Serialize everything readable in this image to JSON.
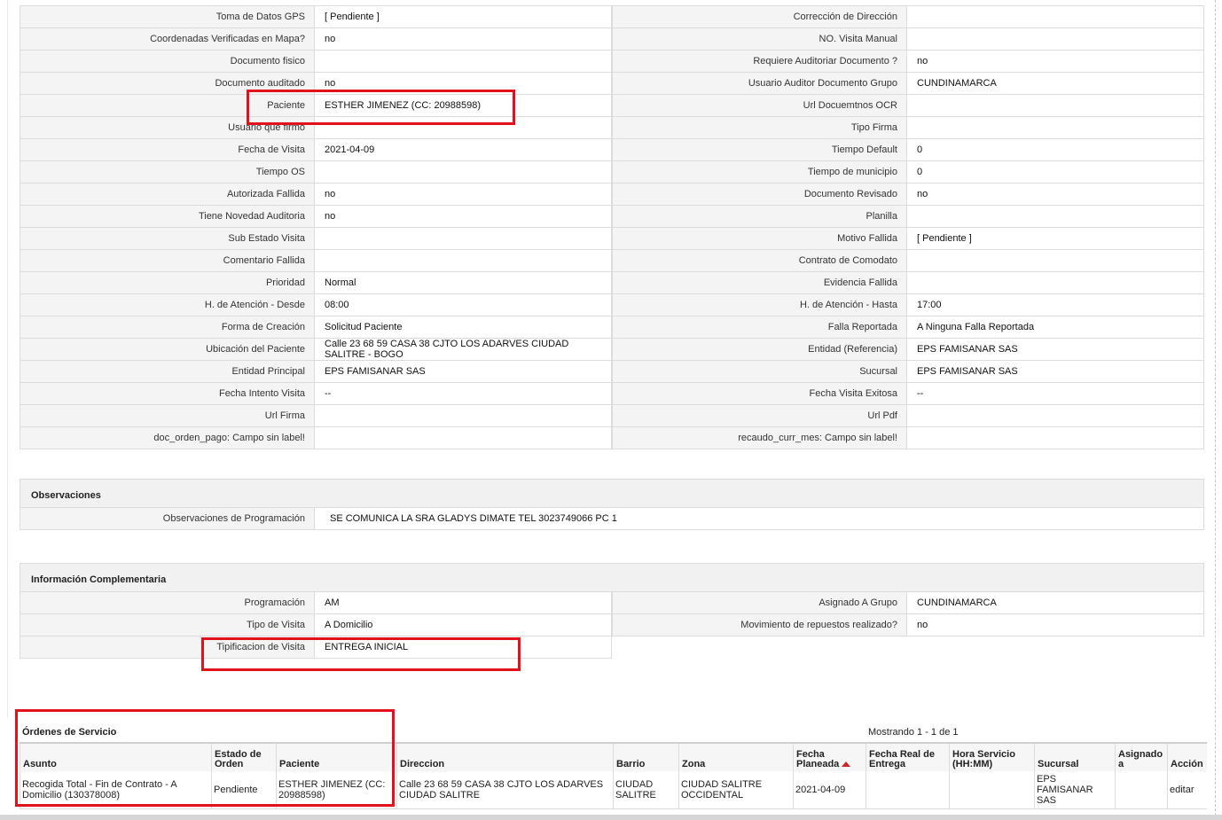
{
  "main_rows": [
    {
      "l1": "Toma de Datos GPS",
      "v1": "[ Pendiente ]",
      "l2": "Corrección de Dirección",
      "v2": ""
    },
    {
      "l1": "Coordenadas Verificadas en Mapa?",
      "v1": "no",
      "l2": "NO. Visita Manual",
      "v2": ""
    },
    {
      "l1": "Documento fisico",
      "v1": "",
      "l2": "Requiere Auditoriar Documento ?",
      "v2": "no"
    },
    {
      "l1": "Documento auditado",
      "v1": "no",
      "l2": "Usuario Auditor Documento Grupo",
      "v2": "CUNDINAMARCA"
    },
    {
      "l1": "Paciente",
      "v1": "ESTHER JIMENEZ (CC: 20988598)",
      "l2": "Url Docuemtnos OCR",
      "v2": ""
    },
    {
      "l1": "Usuario que firmo",
      "v1": "",
      "l2": "Tipo Firma",
      "v2": ""
    },
    {
      "l1": "Fecha de Visita",
      "v1": "2021-04-09",
      "l2": "Tiempo Default",
      "v2": "0"
    },
    {
      "l1": "Tiempo OS",
      "v1": "",
      "l2": "Tiempo de municipio",
      "v2": "0"
    },
    {
      "l1": "Autorizada Fallida",
      "v1": "no",
      "l2": "Documento Revisado",
      "v2": "no"
    },
    {
      "l1": "Tiene Novedad Auditoria",
      "v1": "no",
      "l2": "Planilla",
      "v2": ""
    },
    {
      "l1": "Sub Estado Visita",
      "v1": "",
      "l2": "Motivo Fallida",
      "v2": "[ Pendiente ]"
    },
    {
      "l1": "Comentario Fallida",
      "v1": "",
      "l2": "Contrato de Comodato",
      "v2": ""
    },
    {
      "l1": "Prioridad",
      "v1": "Normal",
      "l2": "Evidencia Fallida",
      "v2": ""
    },
    {
      "l1": "H. de Atención - Desde",
      "v1": "08:00",
      "l2": "H. de Atención - Hasta",
      "v2": "17:00"
    },
    {
      "l1": "Forma de Creación",
      "v1": "Solicitud Paciente",
      "l2": "Falla Reportada",
      "v2": "A Ninguna Falla Reportada"
    },
    {
      "l1": "Ubicación del Paciente",
      "v1": "Calle 23 68 59 CASA 38 CJTO LOS ADARVES CIUDAD SALITRE - BOGO",
      "l2": "Entidad (Referencia)",
      "v2": "EPS FAMISANAR SAS"
    },
    {
      "l1": "Entidad Principal",
      "v1": "EPS FAMISANAR SAS",
      "l2": "Sucursal",
      "v2": "EPS FAMISANAR SAS"
    },
    {
      "l1": "Fecha Intento Visita",
      "v1": "--",
      "l2": "Fecha Visita Exitosa",
      "v2": "--"
    },
    {
      "l1": "Url Firma",
      "v1": "",
      "l2": "Url Pdf",
      "v2": ""
    },
    {
      "l1": "doc_orden_pago: Campo sin label!",
      "v1": "",
      "l2": "recaudo_curr_mes: Campo sin label!",
      "v2": ""
    }
  ],
  "observaciones": {
    "title": "Observaciones",
    "label": "Observaciones de Programación",
    "value": "SE COMUNICA LA SRA GLADYS DIMATE TEL 3023749066 PC 1"
  },
  "complementaria": {
    "title": "Información Complementaria",
    "rows": [
      {
        "l1": "Programación",
        "v1": "AM",
        "l2": "Asignado A Grupo",
        "v2": "CUNDINAMARCA"
      },
      {
        "l1": "Tipo de Visita",
        "v1": "A Domicilio",
        "l2": "Movimiento de repuestos realizado?",
        "v2": "no"
      },
      {
        "l1": "Tipificacion de Visita",
        "v1": "ENTREGA INICIAL"
      }
    ]
  },
  "orders": {
    "title": "Órdenes de Servicio",
    "showing": "Mostrando 1 - 1 de 1",
    "headers": [
      "Asunto",
      "Estado de Orden",
      "Paciente",
      "Direccion",
      "Barrio",
      "Zona",
      "Fecha Planeada",
      "Fecha Real de Entrega",
      "Hora Servicio (HH:MM)",
      "Sucursal",
      "Asignado a",
      "Acción"
    ],
    "row": [
      "Recogida Total - Fin de Contrato - A Domicilio (130378008)",
      "Pendiente",
      "ESTHER JIMENEZ (CC: 20988598)",
      "Calle 23 68 59 CASA 38 CJTO LOS ADARVES CIUDAD SALITRE",
      "CIUDAD SALITRE",
      "CIUDAD SALITRE OCCIDENTAL",
      "2021-04-09",
      "",
      "",
      "EPS FAMISANAR SAS",
      "",
      "editar"
    ]
  }
}
